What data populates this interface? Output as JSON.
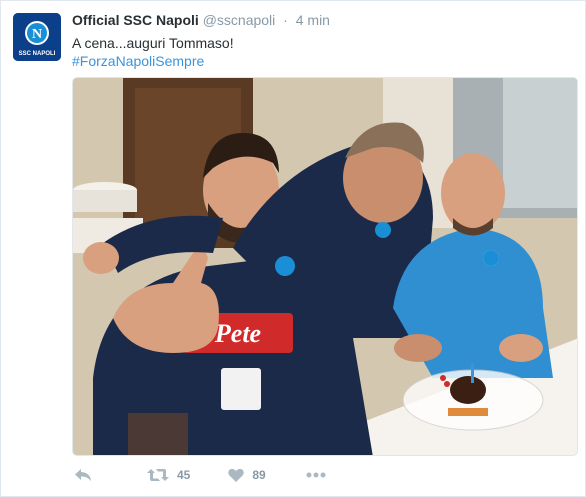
{
  "tweet": {
    "author": {
      "name": "Official SSC Napoli",
      "handle": "@sscnapoli",
      "avatar_text": "SSC NAPOLI",
      "avatar_letter": "N"
    },
    "time": "4 min",
    "separator": "·",
    "text": "A cena...auguri Tommaso!",
    "hashtag": "#ForzaNapoliSempre",
    "photo": {
      "sponsor_logo": "Pete"
    },
    "actions": {
      "reply_icon": "reply-icon",
      "retweet_icon": "retweet-icon",
      "retweets": "45",
      "like_icon": "heart-icon",
      "likes": "89",
      "more_icon": "more-icon"
    }
  },
  "colors": {
    "name": "#292f33",
    "meta": "#8899a6",
    "hashtag": "#3b94d9",
    "action_icon": "#aab8c2",
    "border": "#e1e8ed",
    "napoli_blue": "#0b3f8a"
  }
}
